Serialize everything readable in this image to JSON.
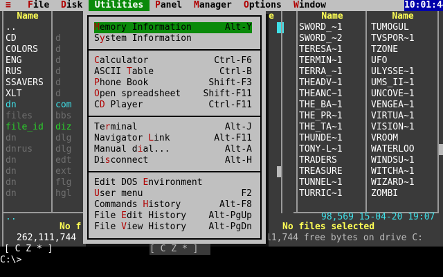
{
  "menubar": {
    "sys_icon": "≡",
    "items": [
      {
        "label": "File",
        "hk": "F",
        "rest": "ile"
      },
      {
        "label": "Disk",
        "hk": "D",
        "rest": "isk"
      },
      {
        "label": "Utilities",
        "hk": "U",
        "rest": "tilities"
      },
      {
        "label": "Panel",
        "hk": "P",
        "rest": "anel"
      },
      {
        "label": "Manager",
        "hk": "M",
        "rest": "anager"
      },
      {
        "label": "Options",
        "hk": "O",
        "rest": "ptions"
      },
      {
        "label": "Window",
        "hk": "W",
        "rest": "indow"
      }
    ],
    "clock": "10:01:44"
  },
  "left_panel": {
    "header": "Name",
    "files": [
      "..",
      "CD",
      "COLORS",
      "ENG",
      "RUS",
      "SSAVERS",
      "XLT",
      "dn",
      "files",
      "file_id",
      "dn",
      "dnrus",
      "dn",
      "dn",
      "dn",
      "dn"
    ],
    "ext_col": [
      "",
      "d",
      "d",
      "d",
      "d",
      "d",
      "d",
      "com",
      "bbs",
      "diz",
      "dlg",
      "dlg",
      "edt",
      "ext",
      "flg",
      "hgl"
    ],
    "bottom_path": "..",
    "bottom_msg": "No f",
    "free": "262,111,744",
    "drives": "[ C Z * ]"
  },
  "right_panel": {
    "col1_header": "Name",
    "col2_header": "Name",
    "col1": [
      "SWORD_~1",
      "SWORD_~2",
      "TERESA~1",
      "TERMIN~1",
      "TERRA_~1",
      "THEADV~1",
      "THEANC~1",
      "THE_BA~1",
      "THE_PR~1",
      "THE_TA~1",
      "THUNDE~1",
      "TONY-L~1",
      "TRADERS",
      "TREASURE",
      "TUNNEL~1",
      "TURRIC~1"
    ],
    "col2": [
      "TUMOGUL",
      "TVSPOR~1",
      "TZONE",
      "UFO",
      "ULYSSE~1",
      "UMS_II~1",
      "UNCOVE~1",
      "VENGEA~1",
      "VIRTUA~1",
      "VISION~1",
      "VROOM",
      "WATERLOO",
      "WINDSU~1",
      "WITCHA~1",
      "WIZARD~1",
      "ZOMBI"
    ],
    "info": "98,569 15-04-20 19:07",
    "no_files": "No files selected",
    "free": "11,744 free bytes on drive C:",
    "drives": "[ C Z * ]"
  },
  "middle_col": {
    "header": "e"
  },
  "dropdown": {
    "groups": [
      [
        {
          "hk": "M",
          "rest": "emory Information",
          "shortcut": "Alt-Y",
          "selected": true
        },
        {
          "pre": "S",
          "hk": "y",
          "rest": "stem Information",
          "shortcut": ""
        }
      ],
      [
        {
          "hk": "C",
          "rest": "alculator",
          "shortcut": "Ctrl-F6"
        },
        {
          "pre": "ASCII ",
          "hk": "T",
          "rest": "able",
          "shortcut": "Ctrl-B"
        },
        {
          "hk": "P",
          "rest": "hone Book",
          "shortcut": "Shift-F3"
        },
        {
          "hk": "O",
          "rest": "pen spreadsheet",
          "shortcut": "Shift-F11"
        },
        {
          "pre": "C",
          "hk": "D",
          "rest": " Player",
          "shortcut": "Ctrl-F11"
        }
      ],
      [
        {
          "pre": "Te",
          "hk": "r",
          "rest": "minal",
          "shortcut": "Alt-J"
        },
        {
          "pre": "Navigator ",
          "hk": "L",
          "rest": "ink",
          "shortcut": "Alt-F11"
        },
        {
          "pre": "Manual d",
          "hk": "i",
          "rest": "al...",
          "shortcut": "Alt-A"
        },
        {
          "pre": "Di",
          "hk": "s",
          "rest": "connect",
          "shortcut": "Alt-H"
        }
      ],
      [
        {
          "pre": "Edit DOS ",
          "hk": "E",
          "rest": "nvironment",
          "shortcut": ""
        },
        {
          "hk": "U",
          "rest": "ser menu",
          "shortcut": "F2"
        },
        {
          "pre": "Commands ",
          "hk": "H",
          "rest": "istory",
          "shortcut": "Alt-F8"
        },
        {
          "pre": "File ",
          "hk": "E",
          "rest": "dit History",
          "shortcut": "Alt-PgUp"
        },
        {
          "pre": "File ",
          "hk": "V",
          "rest": "iew History",
          "shortcut": "Alt-PgDn"
        }
      ]
    ],
    "bottom_drives": "[ C Z * ]"
  },
  "cmdline": {
    "prompt": "C:\\>"
  }
}
